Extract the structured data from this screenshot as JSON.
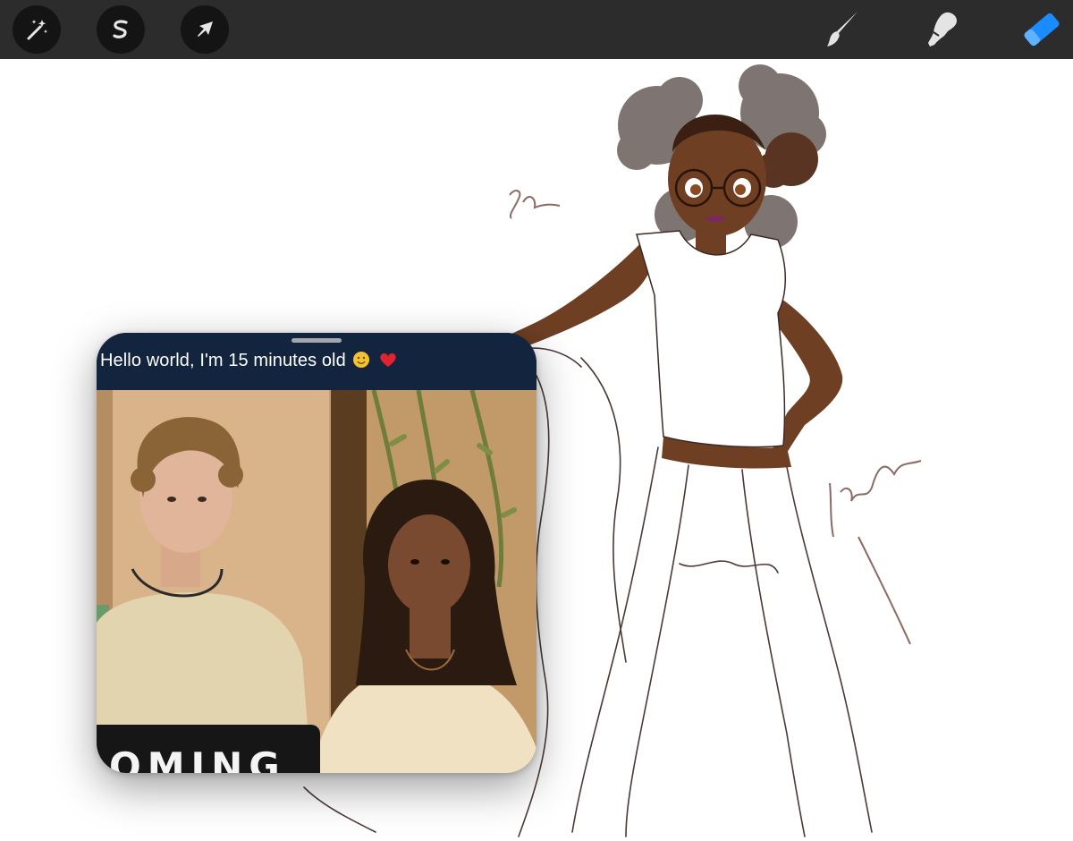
{
  "toolbar": {
    "left_tools": [
      {
        "name": "adjustments",
        "icon": "magic-wand-icon"
      },
      {
        "name": "selection",
        "icon": "selection-s-icon"
      },
      {
        "name": "transform",
        "icon": "arrow-cursor-icon"
      }
    ],
    "right_tools": [
      {
        "name": "brush",
        "icon": "brush-icon",
        "active": false
      },
      {
        "name": "smudge",
        "icon": "smudge-icon",
        "active": false
      },
      {
        "name": "eraser",
        "icon": "eraser-icon",
        "active": true
      }
    ],
    "colors": {
      "background": "#2c2c2c",
      "active_tool": "#1a8cff",
      "inactive_tool": "#e4e4e4"
    }
  },
  "pip_video": {
    "caption": "Hello world, I'm 15 minutes old",
    "caption_emojis": [
      "smiling-face-emoji",
      "red-heart-emoji"
    ],
    "banner_text": "OMING"
  }
}
